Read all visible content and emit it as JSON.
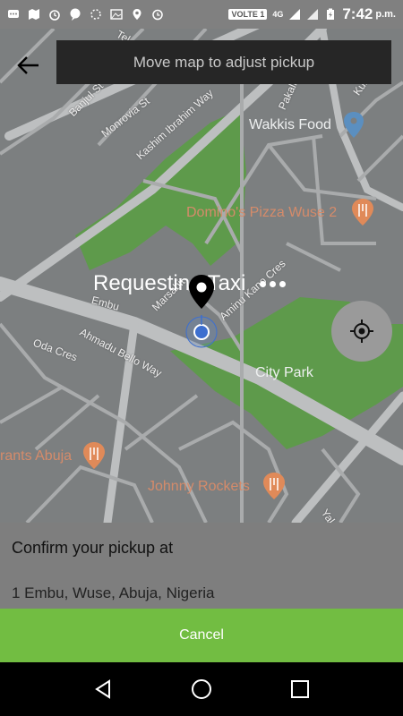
{
  "status_bar": {
    "volte": "VOLTE 1",
    "network": "4G",
    "time": "7:42",
    "ampm": "p.m."
  },
  "header": {
    "hint": "Move map to adjust pickup"
  },
  "map": {
    "streets": [
      "Banjul St",
      "Monrovia St",
      "Kashim Ibrahim Way",
      "Pakali",
      "Kum",
      "Tel",
      "Embu",
      "Marsabit",
      "Aminu Kano Cres",
      "Oda Cres",
      "Ahmadu Bello Way",
      "Yal"
    ],
    "pois": {
      "wakkis": "Wakkis Food",
      "dominos": "Domino's Pizza Wuse 2",
      "city_park": "City Park",
      "rants": "rants Abuja",
      "johnny": "Johnny Rockets"
    },
    "overlay_text": "Requesting Taxi"
  },
  "sheet": {
    "title": "Confirm your pickup at",
    "address": "1 Embu, Wuse, Abuja, Nigeria"
  },
  "actions": {
    "cancel": "Cancel"
  },
  "colors": {
    "accent_green": "#72bd42",
    "park_green": "#5e9a4b",
    "poi_orange": "#d58b6a",
    "location_blue": "#3d6fcf"
  }
}
